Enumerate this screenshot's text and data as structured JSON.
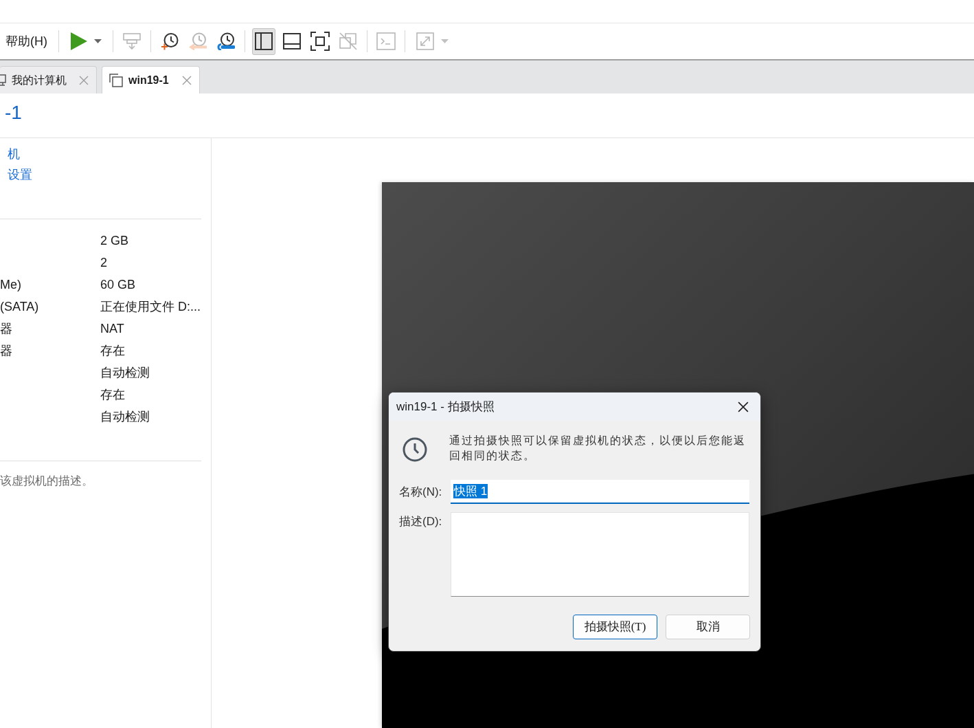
{
  "toolbar": {
    "menu": "帮助(H)",
    "groups": [
      [
        {
          "disabled": false,
          "selected": false,
          "dropdown": true
        }
      ],
      [
        {
          "disabled": true,
          "selected": false,
          "dropdown": false
        }
      ],
      [
        {
          "disabled": false,
          "selected": false,
          "dropdown": false
        },
        {
          "disabled": true,
          "selected": false,
          "dropdown": false
        },
        {
          "disabled": false,
          "selected": false,
          "dropdown": false
        }
      ],
      [
        {
          "disabled": false,
          "selected": true,
          "dropdown": false
        },
        {
          "disabled": false,
          "selected": false,
          "dropdown": false
        },
        {
          "disabled": false,
          "selected": false,
          "dropdown": false
        },
        {
          "disabled": true,
          "selected": false,
          "dropdown": false
        }
      ],
      [
        {
          "disabled": true,
          "selected": false,
          "dropdown": false
        }
      ],
      [
        {
          "disabled": true,
          "selected": false,
          "dropdown": true
        }
      ]
    ]
  },
  "tabs": [
    {
      "label": "我的计算机",
      "selected": false
    },
    {
      "label": "win19-1",
      "selected": true
    }
  ],
  "vm_page": {
    "title": "-1",
    "actions": [
      "机",
      "设置"
    ],
    "devices": [
      {
        "value": "2 GB"
      },
      {
        "value": "2"
      },
      {
        "label": "Me)",
        "value": "60 GB"
      },
      {
        "label": "(SATA)",
        "value": "正在使用文件 D:..."
      },
      {
        "label": "器",
        "value": "NAT"
      },
      {
        "label": "器",
        "value": "存在"
      },
      {
        "value": "自动检测"
      },
      {
        "value": "存在"
      },
      {
        "value": "自动检测"
      }
    ],
    "description": "该虚拟机的描述。"
  },
  "dialog": {
    "title": "win19-1 - 拍摄快照",
    "message": "通过拍摄快照可以保留虚拟机的状态，以便以后您能返回相同的状态。",
    "name_field": {
      "label": "名称(N):",
      "value": "快照 1",
      "focused": true,
      "text_selected": true
    },
    "description_field": {
      "label": "描述(D):"
    },
    "buttons": [
      {
        "label": "拍摄快照(T)",
        "default": true
      },
      {
        "label": "取消",
        "default": false
      }
    ]
  }
}
